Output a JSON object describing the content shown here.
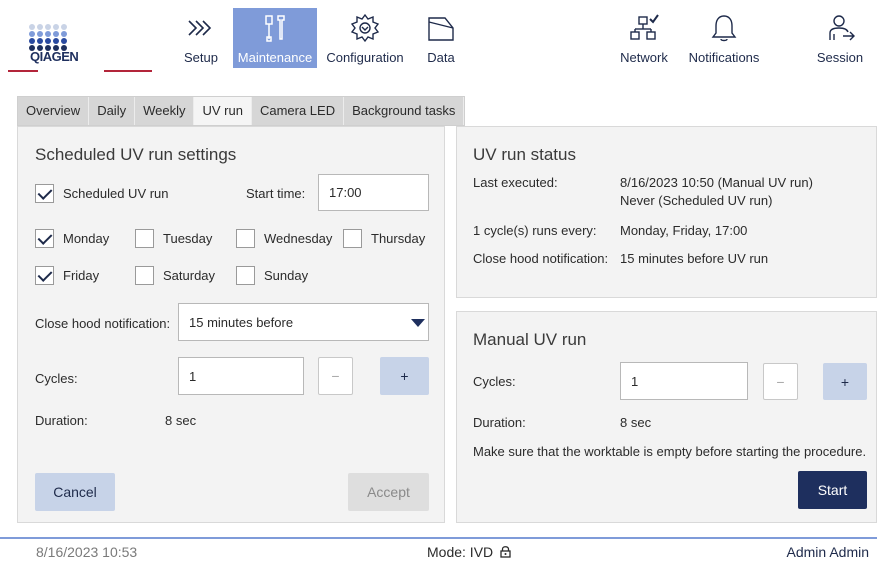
{
  "header": {
    "logo_text": "QIAGEN",
    "nav": [
      {
        "label": "Setup",
        "icon": "setup-chevrons-icon"
      },
      {
        "label": "Maintenance",
        "icon": "maintenance-tools-icon"
      },
      {
        "label": "Configuration",
        "icon": "configuration-gear-icon"
      },
      {
        "label": "Data",
        "icon": "data-folder-icon"
      },
      {
        "label": "Network",
        "icon": "network-icon"
      },
      {
        "label": "Notifications",
        "icon": "bell-icon"
      },
      {
        "label": "Session",
        "icon": "session-user-icon"
      }
    ],
    "active_nav": "Maintenance"
  },
  "tabs": [
    "Overview",
    "Daily",
    "Weekly",
    "UV run",
    "Camera LED",
    "Background tasks"
  ],
  "active_tab": "UV run",
  "scheduled": {
    "title": "Scheduled UV run settings",
    "scheduled_label": "Scheduled UV run",
    "scheduled_checked": true,
    "start_time_label": "Start time:",
    "start_time_value": "17:00",
    "days": [
      {
        "label": "Monday",
        "checked": true
      },
      {
        "label": "Tuesday",
        "checked": false
      },
      {
        "label": "Wednesday",
        "checked": false
      },
      {
        "label": "Thursday",
        "checked": false
      },
      {
        "label": "Friday",
        "checked": true
      },
      {
        "label": "Saturday",
        "checked": false
      },
      {
        "label": "Sunday",
        "checked": false
      }
    ],
    "close_hood_label": "Close hood notification:",
    "close_hood_value": "15 minutes before",
    "cycles_label": "Cycles:",
    "cycles_value": "1",
    "minus": "−",
    "plus": "+",
    "duration_label": "Duration:",
    "duration_value": "8 sec",
    "cancel": "Cancel",
    "accept": "Accept"
  },
  "status": {
    "title": "UV run status",
    "last_executed_label": "Last executed:",
    "last_executed_manual": "8/16/2023 10:50 (Manual UV run)",
    "last_executed_scheduled": "Never (Scheduled UV run)",
    "cycles_label": "1 cycle(s) runs every:",
    "cycles_value": "Monday, Friday, 17:00",
    "close_hood_label": "Close hood notification:",
    "close_hood_value": "15 minutes before UV run"
  },
  "manual": {
    "title": "Manual UV run",
    "cycles_label": "Cycles:",
    "cycles_value": "1",
    "minus": "−",
    "plus": "+",
    "duration_label": "Duration:",
    "duration_value": "8 sec",
    "note": "Make sure that the worktable is empty before starting the procedure.",
    "start": "Start"
  },
  "statusbar": {
    "datetime": "8/16/2023 10:53",
    "mode": "Mode: IVD",
    "user": "Admin Admin"
  }
}
